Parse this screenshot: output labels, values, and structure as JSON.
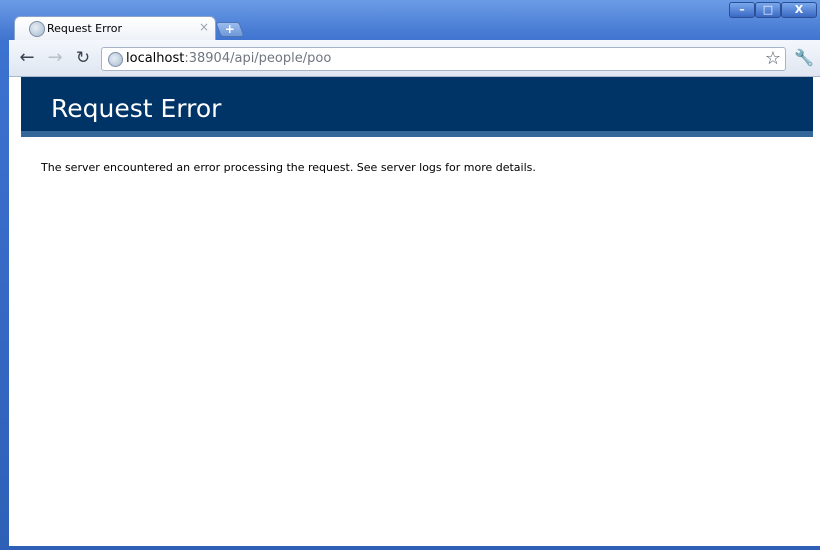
{
  "browser": {
    "tab_title": "Request Error",
    "tab_close": "×",
    "new_tab": "+",
    "caption_min": "–",
    "caption_max": "□",
    "caption_close": "X",
    "url_host": "localhost",
    "url_rest": ":38904/api/people/poo",
    "back_glyph": "←",
    "forward_glyph": "→",
    "reload_glyph": "↻",
    "star_glyph": "☆",
    "wrench_glyph": "🔧"
  },
  "page": {
    "heading": "Request Error",
    "message": "The server encountered an error processing the request. See server logs for more details.",
    "colors": {
      "heading_bg": "#003366",
      "heading_border": "#336699"
    }
  }
}
